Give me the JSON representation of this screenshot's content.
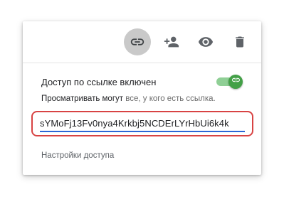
{
  "toolbar": {
    "buttons": [
      {
        "name": "link",
        "icon": "link-icon",
        "active": true
      },
      {
        "name": "add-person",
        "icon": "person-add-icon",
        "active": false
      },
      {
        "name": "preview",
        "icon": "eye-icon",
        "active": false
      },
      {
        "name": "delete",
        "icon": "trash-icon",
        "active": false
      }
    ]
  },
  "sharing": {
    "title": "Доступ по ссылке включен",
    "enabled": true,
    "viewers_label": "Просматривать могут",
    "viewers_value": "все, у кого есть ссылка.",
    "link_value": "sYMoFj13Fv0nya4Krkbj5NCDErLYrHbUi6k4k",
    "settings_label": "Настройки доступа"
  },
  "colors": {
    "toggle_on": "#43a047",
    "highlight_border": "#d84343",
    "focus_underline": "#2b66d6"
  }
}
